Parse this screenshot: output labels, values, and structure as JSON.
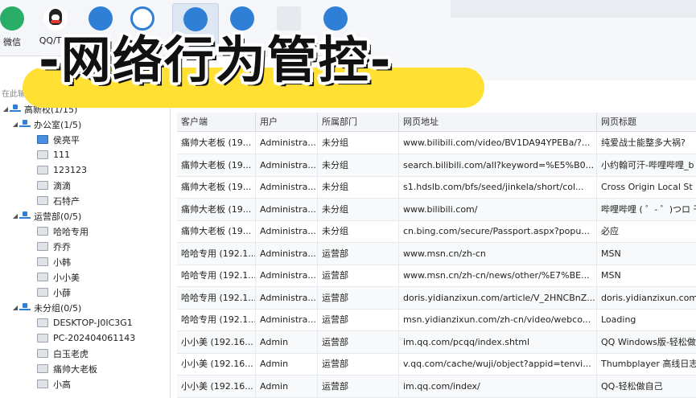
{
  "toolbar": {
    "buttons": [
      {
        "label": "微信",
        "icon": "wechat-icon"
      },
      {
        "label": "QQ/TIM",
        "icon": "qq-icon"
      },
      {
        "label": "",
        "icon": "browser-icon"
      },
      {
        "label": "",
        "icon": "refresh-icon"
      },
      {
        "label": "",
        "icon": "globe-icon"
      },
      {
        "label": "",
        "icon": "globe-icon"
      },
      {
        "label": "",
        "icon": "network-icon"
      },
      {
        "label": "",
        "icon": "globe-icon"
      }
    ]
  },
  "banner": {
    "text": "-网络行为管控-"
  },
  "search_hint": "在此输",
  "tree": [
    {
      "label": "高新校(1/15)",
      "type": "root"
    },
    {
      "label": "办公室(1/5)",
      "type": "group"
    },
    {
      "label": "侯亮平",
      "type": "pc",
      "online": true
    },
    {
      "label": "111",
      "type": "pc"
    },
    {
      "label": "123123",
      "type": "pc"
    },
    {
      "label": "滴滴",
      "type": "pc"
    },
    {
      "label": "石特产",
      "type": "pc"
    },
    {
      "label": "运营部(0/5)",
      "type": "group"
    },
    {
      "label": "哈哈专用",
      "type": "pc"
    },
    {
      "label": "乔乔",
      "type": "pc"
    },
    {
      "label": "小韩",
      "type": "pc"
    },
    {
      "label": "小小美",
      "type": "pc"
    },
    {
      "label": "小薛",
      "type": "pc"
    },
    {
      "label": "未分组(0/5)",
      "type": "group"
    },
    {
      "label": "DESKTOP-J0IC3G1",
      "type": "pc"
    },
    {
      "label": "PC-202404061143",
      "type": "pc"
    },
    {
      "label": "白玉老虎",
      "type": "pc"
    },
    {
      "label": "痛帅大老板",
      "type": "pc"
    },
    {
      "label": "小高",
      "type": "pc"
    }
  ],
  "grid": {
    "columns": [
      "客户端",
      "用户",
      "所属部门",
      "网页地址",
      "网页标题"
    ],
    "rows": [
      [
        "痛帅大老板 (19...",
        "Administra...",
        "未分组",
        "www.bilibili.com/video/BV1DA94YPEBa/?...",
        "纯爱战士能整多大祸?"
      ],
      [
        "痛帅大老板 (19...",
        "Administra...",
        "未分组",
        "search.bilibili.com/all?keyword=%E5%B0...",
        "小约翰可汗-哔哩哔哩_b"
      ],
      [
        "痛帅大老板 (19...",
        "Administra...",
        "未分组",
        "s1.hdslb.com/bfs/seed/jinkela/short/col...",
        "Cross Origin Local St"
      ],
      [
        "痛帅大老板 (19...",
        "Administra...",
        "未分组",
        "www.bilibili.com/",
        "哔哩哔哩 ( ゜- ゜)つロ 干"
      ],
      [
        "痛帅大老板 (19...",
        "Administra...",
        "未分组",
        "cn.bing.com/secure/Passport.aspx?popu...",
        "必应"
      ],
      [
        "哈哈专用 (192.1...",
        "Administra...",
        "运营部",
        "www.msn.cn/zh-cn",
        "MSN"
      ],
      [
        "哈哈专用 (192.1...",
        "Administra...",
        "运营部",
        "www.msn.cn/zh-cn/news/other/%E7%BE...",
        "MSN"
      ],
      [
        "哈哈专用 (192.1...",
        "Administra...",
        "运营部",
        "doris.yidianzixun.com/article/V_2HNCBnZ...",
        "doris.yidianzixun.com"
      ],
      [
        "哈哈专用 (192.1...",
        "Administra...",
        "运营部",
        "msn.yidianzixun.com/zh-cn/video/webco...",
        "Loading"
      ],
      [
        "小小美 (192.16...",
        "Admin",
        "运营部",
        "im.qq.com/pcqq/index.shtml",
        "QQ Windows版-轻松做"
      ],
      [
        "小小美 (192.16...",
        "Admin",
        "运营部",
        "v.qq.com/cache/wuji/object?appid=tenvi...",
        "Thumbplayer 高线日志"
      ],
      [
        "小小美 (192.16...",
        "Admin",
        "运营部",
        "im.qq.com/index/",
        "QQ-轻松做自己"
      ]
    ]
  },
  "colors": {
    "accent": "#2f7fd6",
    "banner": "#ffe033",
    "header_bg": "#f3f5f8"
  }
}
